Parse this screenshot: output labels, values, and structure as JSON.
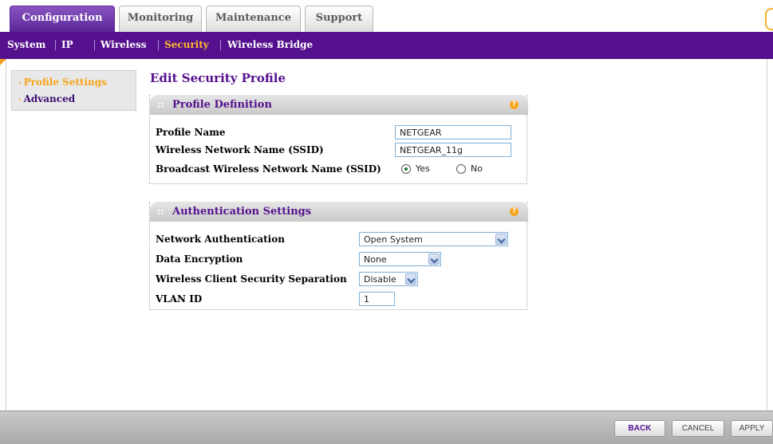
{
  "tabs": [
    {
      "label": "Configuration",
      "active": true
    },
    {
      "label": "Monitoring",
      "active": false
    },
    {
      "label": "Maintenance",
      "active": false
    },
    {
      "label": "Support",
      "active": false
    }
  ],
  "subnav": [
    {
      "label": "System",
      "active": false
    },
    {
      "label": "IP",
      "active": false
    },
    {
      "label": "Wireless",
      "active": false
    },
    {
      "label": "Security",
      "active": true
    },
    {
      "label": "Wireless Bridge",
      "active": false
    }
  ],
  "leftmenu": [
    {
      "label": "Profile Settings",
      "active": true
    },
    {
      "label": "Advanced",
      "active": false
    }
  ],
  "page_title": "Edit Security Profile",
  "profile_definition": {
    "title": "Profile Definition",
    "help_icon": "?",
    "profile_name_label": "Profile Name",
    "profile_name_value": "NETGEAR",
    "ssid_label": "Wireless Network Name (SSID)",
    "ssid_value": "NETGEAR_11g",
    "broadcast_label": "Broadcast Wireless Network Name (SSID)",
    "broadcast_yes": "Yes",
    "broadcast_no": "No",
    "broadcast_selected": "Yes"
  },
  "authentication": {
    "title": "Authentication Settings",
    "help_icon": "?",
    "network_auth_label": "Network Authentication",
    "network_auth_value": "Open System",
    "data_encryption_label": "Data Encryption",
    "data_encryption_value": "None",
    "separation_label": "Wireless Client Security Separation",
    "separation_value": "Disable",
    "vlan_label": "VLAN ID",
    "vlan_value": "1"
  },
  "footer": {
    "back": "BACK",
    "cancel": "CANCEL",
    "apply": "APPLY"
  },
  "colors": {
    "brand_purple": "#55108e",
    "accent_orange": "#f7a51c"
  }
}
